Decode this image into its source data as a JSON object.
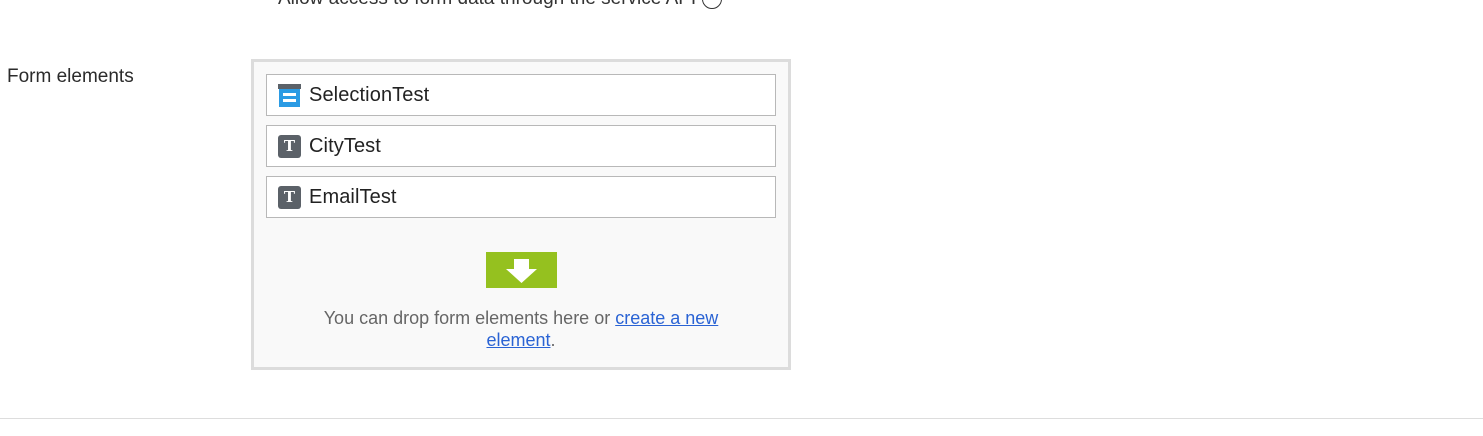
{
  "top_setting": {
    "label": "Allow access to form data through the service API"
  },
  "form_elements": {
    "label": "Form elements",
    "items": [
      {
        "name": "SelectionTest",
        "icon": "selection-icon"
      },
      {
        "name": "CityTest",
        "icon": "text-icon"
      },
      {
        "name": "EmailTest",
        "icon": "text-icon"
      }
    ],
    "drop_text": "You can drop form elements here or",
    "create_link": "create a new element",
    "drop_text_end": ".",
    "drop_icon": "drop-down-arrow-icon"
  },
  "colors": {
    "drop_accent": "#95c11f",
    "link": "#2a63d4",
    "text_icon_bg": "#5b6168",
    "selection_icon": "#2b9be4"
  }
}
